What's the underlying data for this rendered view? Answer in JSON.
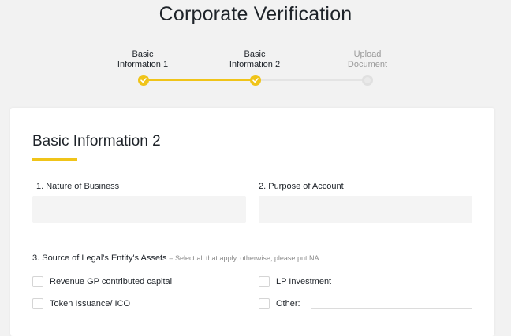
{
  "page": {
    "title": "Corporate Verification"
  },
  "stepper": {
    "steps": [
      {
        "label_line1": "Basic",
        "label_line2": "Information 1",
        "status": "done"
      },
      {
        "label_line1": "Basic",
        "label_line2": "Information 2",
        "status": "done"
      },
      {
        "label_line1": "Upload",
        "label_line2": "Document",
        "status": "pending"
      }
    ],
    "colors": {
      "accent": "#f0c419",
      "pending": "#e4e4e4"
    }
  },
  "form": {
    "section_title": "Basic Information 2",
    "fields": {
      "nature_of_business": {
        "label": "1. Nature of Business",
        "value": ""
      },
      "purpose_of_account": {
        "label": "2. Purpose of Account",
        "value": ""
      }
    },
    "assets": {
      "label": "3. Source of Legal's Entity's Assets",
      "hint": "– Select all that apply, otherwise, please put NA",
      "options": [
        {
          "label": "Revenue GP contributed capital",
          "checked": false
        },
        {
          "label": "LP Investment",
          "checked": false
        },
        {
          "label": "Token Issuance/ ICO",
          "checked": false
        },
        {
          "label": "Other:",
          "checked": false
        }
      ],
      "other_value": ""
    }
  }
}
